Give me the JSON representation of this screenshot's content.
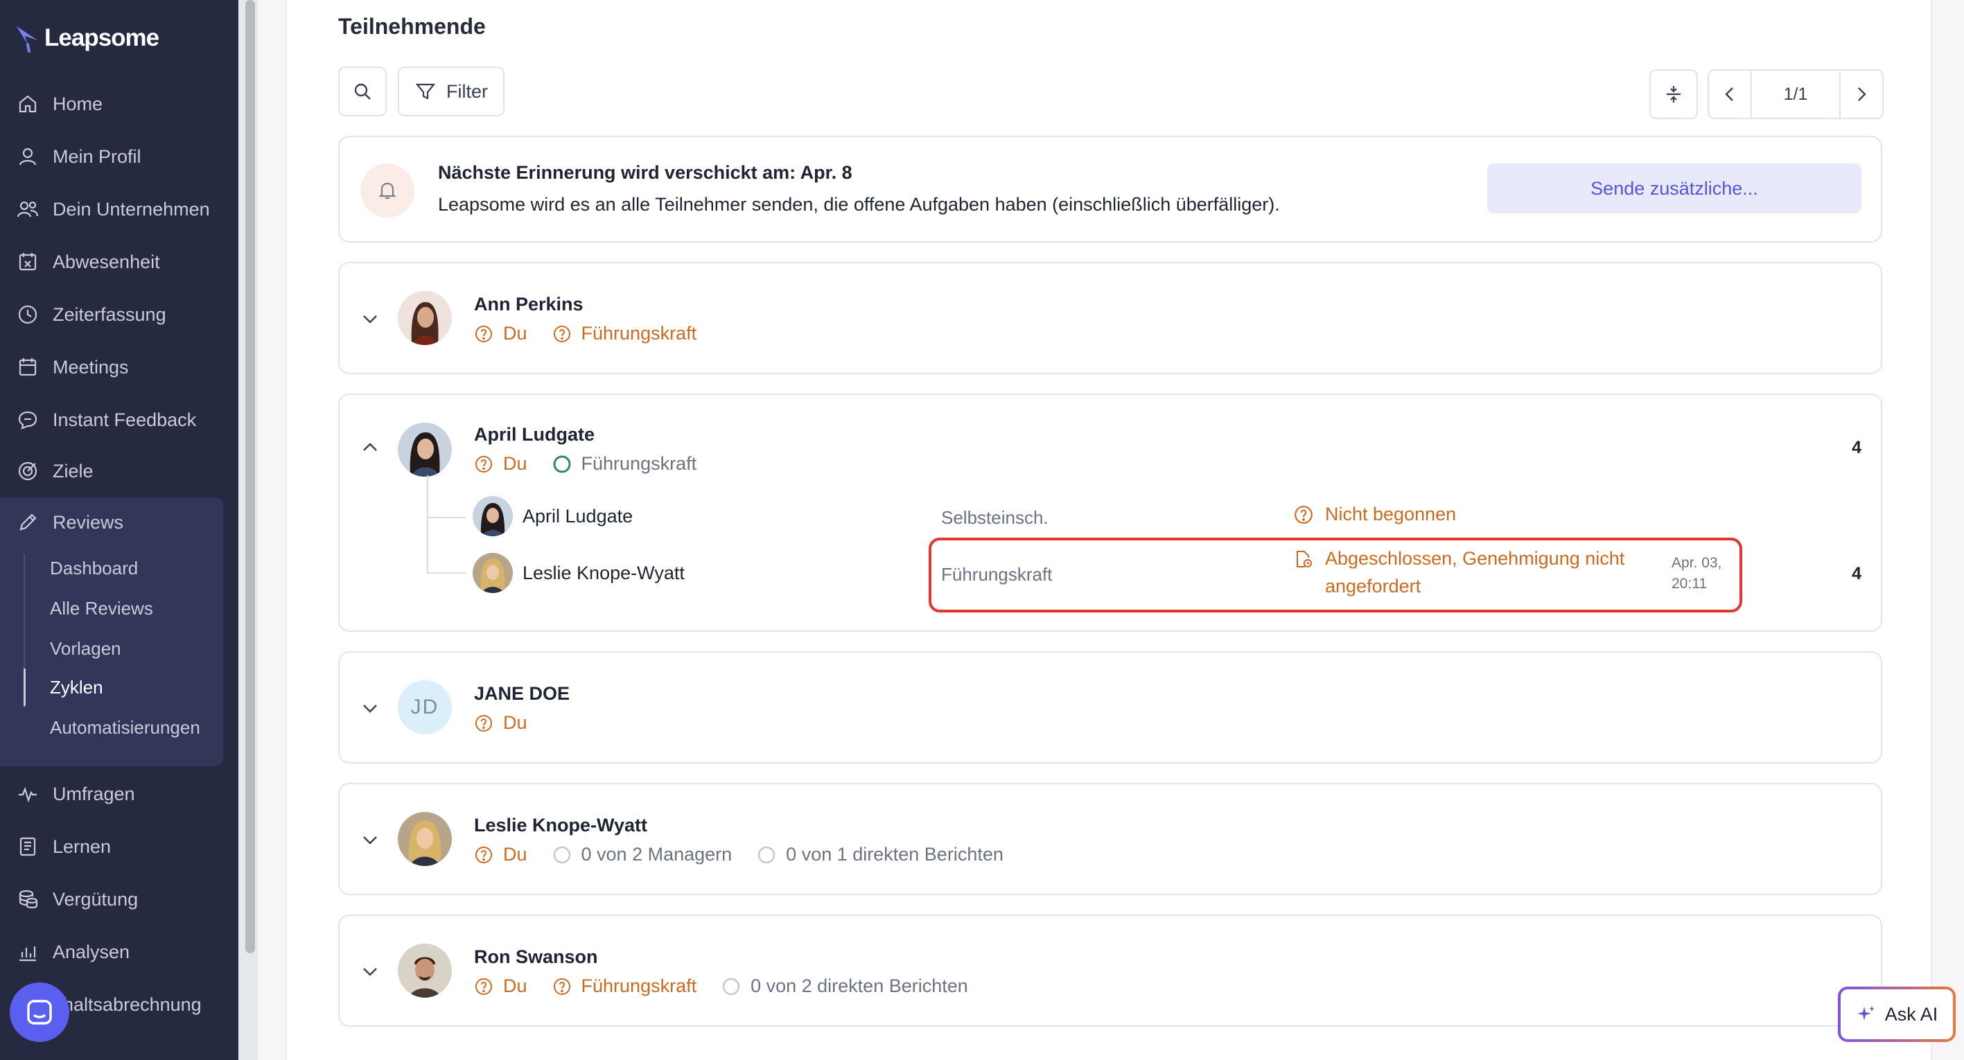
{
  "app": {
    "brand": "Leapsome"
  },
  "sidebar": {
    "items": [
      {
        "label": "Home",
        "icon": "home-icon"
      },
      {
        "label": "Mein Profil",
        "icon": "user-icon"
      },
      {
        "label": "Dein Unternehmen",
        "icon": "users-icon"
      },
      {
        "label": "Abwesenheit",
        "icon": "calendar-x-icon"
      },
      {
        "label": "Zeiterfassung",
        "icon": "clock-icon"
      },
      {
        "label": "Meetings",
        "icon": "calendar-icon"
      },
      {
        "label": "Instant Feedback",
        "icon": "chat-icon"
      },
      {
        "label": "Ziele",
        "icon": "target-icon"
      },
      {
        "label": "Reviews",
        "icon": "pencil-icon"
      },
      {
        "label": "Umfragen",
        "icon": "pulse-icon"
      },
      {
        "label": "Lernen",
        "icon": "book-icon"
      },
      {
        "label": "Vergütung",
        "icon": "coins-icon"
      },
      {
        "label": "Analysen",
        "icon": "chart-icon"
      },
      {
        "label": "ehaltsabrechnung",
        "icon": ""
      }
    ],
    "reviews_sub": [
      "Dashboard",
      "Alle Reviews",
      "Vorlagen",
      "Zyklen",
      "Automatisierungen"
    ],
    "active_sub": "Zyklen"
  },
  "main": {
    "title": "Teilnehmende",
    "filter_label": "Filter",
    "pagination": "1/1",
    "reminder": {
      "title": "Nächste Erinnerung wird verschickt am: Apr. 8",
      "text": "Leapsome wird es an alle Teilnehmer senden, die offene Aufgaben haben (einschließlich überfälliger).",
      "button": "Sende zusätzliche..."
    },
    "participants": [
      {
        "name": "Ann Perkins",
        "chips": [
          "Du",
          "Führungskraft"
        ]
      },
      {
        "name": "April Ludgate",
        "chips": [
          "Du",
          "Führungskraft"
        ],
        "count": "4",
        "reviewers": [
          {
            "name": "April Ludgate",
            "type": "Selbsteinsch.",
            "status": "Nicht begonnen"
          },
          {
            "name": "Leslie Knope-Wyatt",
            "type": "Führungskraft",
            "status_line1": "Abgeschlossen, Genehmigung nicht",
            "status_line2": "angefordert",
            "date_line1": "Apr. 03,",
            "date_line2": "20:11",
            "count": "4"
          }
        ]
      },
      {
        "name": "JANE DOE",
        "initials": "JD",
        "chips": [
          "Du"
        ]
      },
      {
        "name": "Leslie Knope-Wyatt",
        "chips": [
          "Du",
          "0 von 2 Managern",
          "0 von 1 direkten Berichten"
        ]
      },
      {
        "name": "Ron Swanson",
        "chips": [
          "Du",
          "Führungskraft",
          "0 von 2 direkten Berichten"
        ]
      }
    ]
  },
  "ask_ai": "Ask AI",
  "colors": {
    "sidebar": "#262a41",
    "accent": "#5356d8",
    "orange": "#cc6a1f",
    "highlight": "#e0382e"
  }
}
